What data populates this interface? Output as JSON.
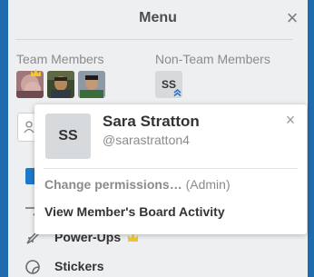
{
  "menu": {
    "title": "Menu",
    "close_glyph": "×"
  },
  "team_members": {
    "label": "Team Members",
    "avatars": [
      {
        "name": "team-member-avatar-1",
        "admin_badge": true
      },
      {
        "name": "team-member-avatar-2"
      },
      {
        "name": "team-member-avatar-3"
      }
    ]
  },
  "non_team_members": {
    "label": "Non-Team Members",
    "avatars": [
      {
        "initials": "SS",
        "badge_glyph": "»"
      }
    ]
  },
  "popover": {
    "avatar_initials": "SS",
    "full_name": "Sara Stratton",
    "username": "@sarastratton4",
    "close_glyph": "×",
    "change_permissions_label": "Change permissions…",
    "permission_level": "(Admin)",
    "view_activity_label": "View Member's Board Activity"
  },
  "menu_items": [
    {
      "label": "Power-Ups",
      "icon": "rocket-icon",
      "badge_icon": "crown-icon"
    },
    {
      "label": "Stickers",
      "icon": "sticker-icon"
    }
  ],
  "colors": {
    "board_background": "#1f6bb0",
    "panel_background": "#eeeff1",
    "crown": "#f2c62f",
    "permission_badge": "#2f6fbf"
  }
}
